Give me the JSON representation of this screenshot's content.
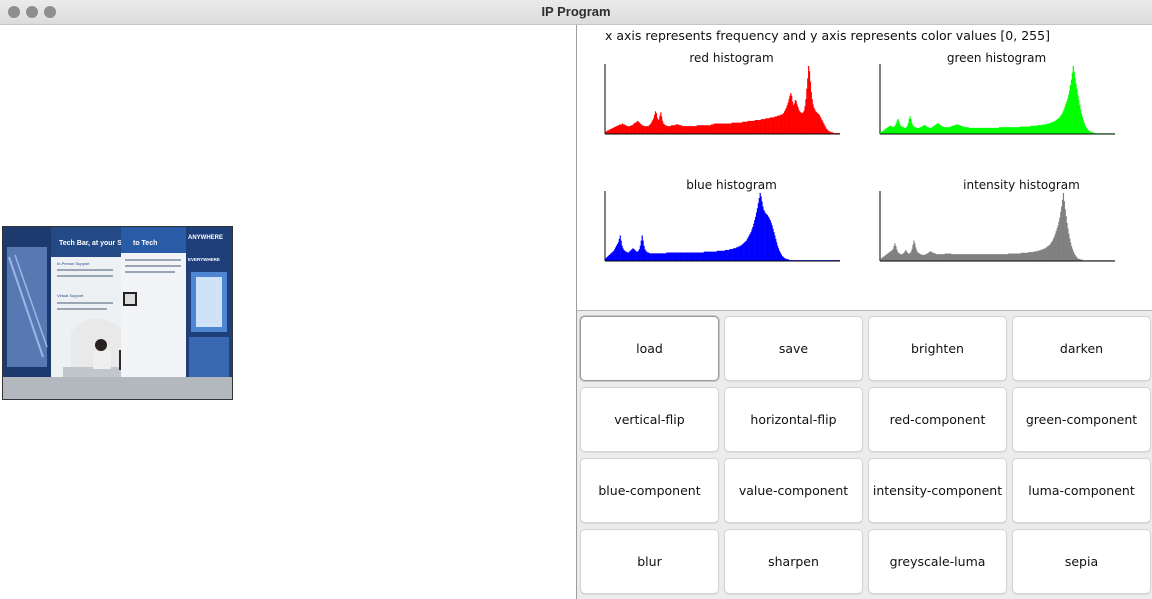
{
  "window": {
    "title": "IP Program"
  },
  "histogram_panel": {
    "caption": "x axis represents frequency and y axis represents color values [0, 255]",
    "histograms": [
      {
        "label": "red histogram",
        "color": "#ff0000"
      },
      {
        "label": "green histogram",
        "color": "#00ff00"
      },
      {
        "label": "blue histogram",
        "color": "#0000ff"
      },
      {
        "label": "intensity histogram",
        "color": "#808080"
      }
    ]
  },
  "buttons": [
    "load",
    "save",
    "brighten",
    "darken",
    "vertical-flip",
    "horizontal-flip",
    "red-component",
    "green-component",
    "blue-component",
    "value-component",
    "intensity-component",
    "luma-component",
    "blur",
    "sharpen",
    "greyscale-luma",
    "sepia"
  ],
  "photo": {
    "sign_texts": [
      "Tech Bar, at your Service",
      "to Tech",
      "ANYWHERE",
      "EVERYWHERE",
      "In-Person Support",
      "Virtual Support"
    ]
  },
  "chart_data": [
    {
      "type": "area",
      "title": "red histogram",
      "xlim": [
        0,
        255
      ],
      "values": [
        3,
        3,
        4,
        4,
        5,
        5,
        6,
        6,
        7,
        7,
        8,
        8,
        9,
        9,
        10,
        10,
        11,
        11,
        11,
        12,
        11,
        11,
        10,
        10,
        9,
        9,
        9,
        9,
        9,
        10,
        10,
        11,
        12,
        13,
        13,
        14,
        15,
        14,
        13,
        12,
        11,
        10,
        10,
        9,
        9,
        9,
        9,
        9,
        9,
        10,
        11,
        12,
        14,
        16,
        18,
        22,
        26,
        24,
        19,
        16,
        17,
        21,
        25,
        20,
        15,
        12,
        11,
        10,
        10,
        9,
        9,
        9,
        9,
        9,
        10,
        10,
        10,
        10,
        10,
        11,
        11,
        11,
        11,
        10,
        10,
        10,
        9,
        9,
        9,
        9,
        9,
        9,
        9,
        9,
        9,
        9,
        9,
        9,
        9,
        9,
        9,
        9,
        9,
        10,
        10,
        10,
        10,
        10,
        10,
        10,
        10,
        10,
        10,
        10,
        10,
        10,
        10,
        10,
        10,
        11,
        11,
        11,
        12,
        12,
        12,
        12,
        12,
        12,
        12,
        12,
        12,
        12,
        12,
        12,
        12,
        12,
        12,
        12,
        12,
        12,
        12,
        12,
        13,
        13,
        13,
        13,
        13,
        13,
        13,
        13,
        13,
        13,
        13,
        13,
        14,
        14,
        14,
        14,
        14,
        14,
        15,
        15,
        15,
        15,
        15,
        15,
        15,
        15,
        16,
        16,
        16,
        16,
        16,
        16,
        16,
        17,
        17,
        17,
        17,
        17,
        18,
        18,
        18,
        18,
        18,
        19,
        19,
        19,
        19,
        19,
        20,
        20,
        20,
        21,
        21,
        21,
        22,
        22,
        22,
        23,
        24,
        26,
        28,
        30,
        33,
        36,
        40,
        44,
        47,
        44,
        37,
        33,
        35,
        39,
        38,
        34,
        31,
        28,
        26,
        25,
        24,
        24,
        25,
        27,
        32,
        40,
        52,
        64,
        78,
        72,
        60,
        48,
        40,
        34,
        30,
        28,
        26,
        25,
        24,
        23,
        22,
        20,
        18,
        16,
        14,
        12,
        10,
        8,
        6,
        5,
        4,
        3,
        3,
        2,
        2,
        2,
        1,
        1,
        1,
        1,
        1,
        1,
        1,
        1,
        1
      ]
    },
    {
      "type": "area",
      "title": "green histogram",
      "xlim": [
        0,
        255
      ],
      "values": [
        3,
        3,
        4,
        5,
        6,
        7,
        8,
        9,
        10,
        11,
        12,
        12,
        11,
        10,
        10,
        11,
        13,
        16,
        20,
        22,
        18,
        14,
        12,
        11,
        10,
        10,
        9,
        9,
        10,
        12,
        16,
        22,
        26,
        22,
        16,
        13,
        11,
        10,
        10,
        9,
        9,
        9,
        9,
        10,
        10,
        11,
        12,
        13,
        13,
        12,
        11,
        10,
        10,
        9,
        9,
        9,
        10,
        11,
        12,
        13,
        14,
        15,
        16,
        15,
        14,
        13,
        12,
        11,
        11,
        10,
        10,
        10,
        10,
        10,
        10,
        10,
        11,
        11,
        12,
        12,
        13,
        13,
        14,
        14,
        14,
        13,
        13,
        12,
        12,
        11,
        11,
        10,
        10,
        10,
        10,
        10,
        9,
        9,
        9,
        9,
        9,
        9,
        9,
        9,
        9,
        9,
        9,
        9,
        9,
        9,
        9,
        9,
        9,
        9,
        9,
        9,
        9,
        9,
        9,
        9,
        9,
        9,
        9,
        9,
        9,
        9,
        9,
        9,
        9,
        10,
        10,
        10,
        10,
        10,
        10,
        10,
        10,
        10,
        10,
        10,
        10,
        10,
        10,
        10,
        10,
        10,
        10,
        10,
        10,
        10,
        10,
        10,
        11,
        11,
        11,
        11,
        11,
        11,
        11,
        11,
        11,
        11,
        11,
        12,
        12,
        12,
        12,
        12,
        12,
        12,
        13,
        13,
        13,
        13,
        13,
        13,
        14,
        14,
        14,
        14,
        15,
        15,
        15,
        16,
        16,
        17,
        17,
        18,
        18,
        19,
        20,
        21,
        22,
        23,
        24,
        26,
        28,
        30,
        33,
        36,
        40,
        44,
        48,
        52,
        58,
        64,
        72,
        80,
        90,
        100,
        92,
        82,
        74,
        66,
        58,
        50,
        43,
        36,
        30,
        25,
        20,
        16,
        12,
        10,
        8,
        6,
        5,
        4,
        3,
        3,
        2,
        2,
        2,
        1,
        1,
        1,
        1,
        1,
        1,
        1,
        1,
        1,
        1,
        1,
        1,
        1,
        1,
        1,
        1,
        1,
        1,
        1,
        1,
        1,
        1,
        1
      ]
    },
    {
      "type": "area",
      "title": "blue histogram",
      "xlim": [
        0,
        255
      ],
      "values": [
        3,
        4,
        5,
        6,
        7,
        8,
        9,
        10,
        11,
        12,
        14,
        16,
        18,
        20,
        22,
        26,
        30,
        24,
        18,
        15,
        13,
        12,
        11,
        11,
        10,
        10,
        11,
        12,
        13,
        14,
        15,
        14,
        13,
        12,
        11,
        11,
        12,
        14,
        18,
        24,
        30,
        24,
        18,
        14,
        12,
        11,
        10,
        10,
        9,
        9,
        9,
        9,
        9,
        9,
        9,
        9,
        9,
        9,
        9,
        9,
        9,
        9,
        9,
        9,
        9,
        9,
        9,
        10,
        10,
        10,
        10,
        10,
        10,
        10,
        10,
        10,
        10,
        10,
        10,
        10,
        10,
        10,
        10,
        10,
        10,
        10,
        10,
        10,
        10,
        10,
        10,
        10,
        10,
        10,
        10,
        10,
        10,
        10,
        10,
        10,
        10,
        10,
        10,
        10,
        10,
        10,
        10,
        10,
        11,
        11,
        11,
        11,
        11,
        11,
        11,
        11,
        11,
        11,
        11,
        11,
        11,
        11,
        12,
        12,
        12,
        12,
        12,
        12,
        12,
        12,
        12,
        13,
        13,
        13,
        13,
        13,
        14,
        14,
        14,
        14,
        15,
        15,
        15,
        16,
        16,
        17,
        17,
        18,
        18,
        19,
        20,
        21,
        22,
        23,
        24,
        26,
        28,
        30,
        32,
        34,
        37,
        40,
        44,
        48,
        52,
        57,
        62,
        68,
        74,
        80,
        76,
        70,
        64,
        60,
        58,
        56,
        55,
        54,
        52,
        50,
        48,
        45,
        42,
        38,
        34,
        30,
        26,
        22,
        18,
        15,
        12,
        10,
        8,
        6,
        5,
        4,
        3,
        3,
        2,
        2,
        2,
        1,
        1,
        1,
        1,
        1,
        1,
        1,
        1,
        1,
        1,
        1,
        1,
        1,
        1,
        1,
        1,
        1,
        1,
        1,
        1,
        1,
        1,
        1,
        1,
        1,
        1,
        1,
        1,
        1,
        1,
        1,
        1,
        1,
        1,
        1,
        1,
        1,
        1,
        1,
        1,
        1,
        1,
        1,
        1,
        1,
        1,
        1,
        1,
        1,
        1,
        1,
        1,
        1,
        1,
        1,
        1,
        1
      ]
    },
    {
      "type": "area",
      "title": "intensity histogram",
      "xlim": [
        0,
        255
      ],
      "values": [
        3,
        4,
        5,
        6,
        7,
        8,
        9,
        10,
        11,
        12,
        13,
        14,
        15,
        16,
        18,
        22,
        26,
        22,
        17,
        14,
        12,
        11,
        10,
        10,
        10,
        11,
        12,
        14,
        16,
        14,
        12,
        11,
        11,
        12,
        14,
        18,
        24,
        30,
        26,
        20,
        16,
        13,
        12,
        11,
        10,
        10,
        9,
        9,
        9,
        9,
        10,
        10,
        11,
        12,
        13,
        14,
        14,
        13,
        12,
        12,
        11,
        11,
        10,
        10,
        10,
        10,
        10,
        10,
        10,
        10,
        10,
        10,
        11,
        11,
        11,
        11,
        11,
        11,
        11,
        10,
        10,
        10,
        10,
        10,
        10,
        10,
        10,
        10,
        10,
        10,
        10,
        10,
        10,
        10,
        10,
        10,
        10,
        10,
        10,
        10,
        10,
        10,
        10,
        10,
        10,
        10,
        10,
        10,
        10,
        10,
        10,
        10,
        10,
        10,
        10,
        10,
        10,
        10,
        10,
        10,
        10,
        10,
        10,
        10,
        10,
        10,
        10,
        10,
        10,
        10,
        10,
        10,
        10,
        10,
        10,
        10,
        10,
        10,
        10,
        10,
        10,
        10,
        11,
        11,
        11,
        11,
        11,
        11,
        11,
        11,
        11,
        11,
        11,
        11,
        11,
        11,
        12,
        12,
        12,
        12,
        12,
        12,
        12,
        12,
        13,
        13,
        13,
        13,
        13,
        13,
        14,
        14,
        14,
        14,
        15,
        15,
        15,
        16,
        16,
        17,
        17,
        18,
        18,
        19,
        20,
        21,
        22,
        23,
        24,
        26,
        28,
        30,
        33,
        36,
        40,
        44,
        48,
        52,
        58,
        64,
        72,
        80,
        90,
        100,
        88,
        76,
        66,
        56,
        48,
        40,
        33,
        27,
        22,
        18,
        14,
        11,
        9,
        7,
        5,
        4,
        3,
        3,
        2,
        2,
        2,
        1,
        1,
        1,
        1,
        1,
        1,
        1,
        1,
        1,
        1,
        1,
        1,
        1,
        1,
        1,
        1,
        1,
        1,
        1,
        1,
        1,
        1,
        1,
        1,
        1,
        1,
        1,
        1,
        1,
        1,
        1,
        1,
        1,
        1,
        1,
        1,
        1
      ]
    }
  ]
}
